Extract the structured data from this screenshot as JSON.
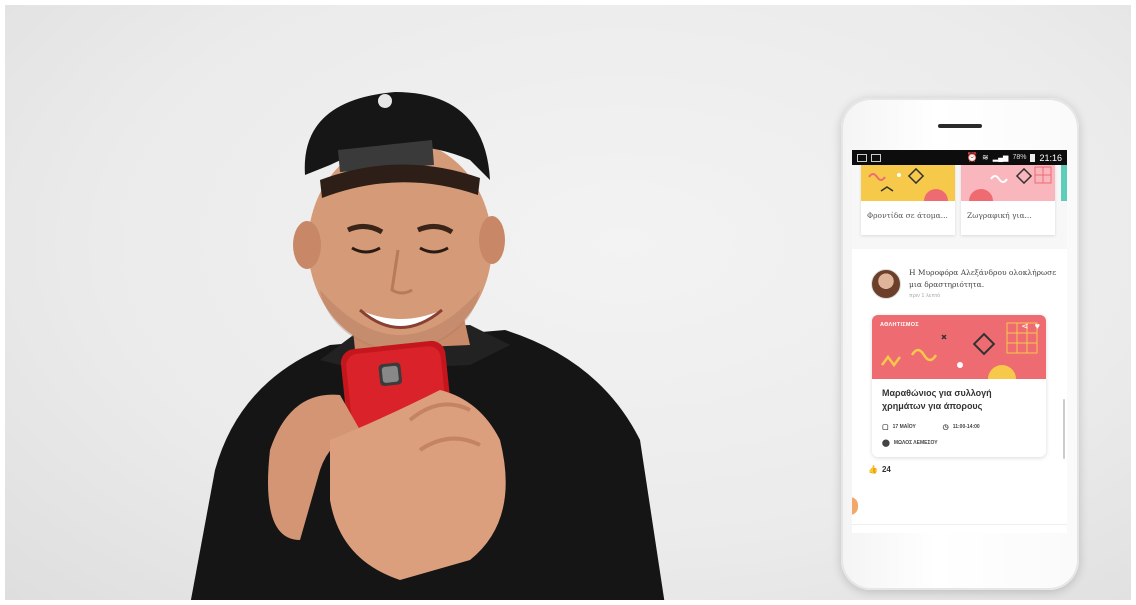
{
  "phone": {
    "status_bar": {
      "battery": "78%",
      "time": "21:16"
    },
    "top_cards": [
      {
        "caption": "Φροντίδα σε άτομα..."
      },
      {
        "caption": "Ζωγραφική για..."
      }
    ],
    "activity": {
      "text": "Η Μυροφόρα Αλεξάνδρου ολοκλήρωσε μια δραστηριότητα.",
      "time": "πριν 1 λεπτό"
    },
    "event": {
      "category": "ΑΘΛΗΤΙΣΜΟΣ",
      "title": "Μαραθώνιος για συλλογή χρημάτων για άπορους",
      "date": "17 ΜΑΪΟΥ",
      "time": "11:00-14:00",
      "location": "ΜΩΛΟΣ ΛΕΜΕΣΟΥ",
      "banner_color": "#ef6b72"
    },
    "likes": {
      "count": "24"
    },
    "nav": {
      "items": [
        {
          "icon": "home-icon",
          "active": true
        },
        {
          "icon": "calendar-icon",
          "active": false
        },
        {
          "icon": "search-icon",
          "active": false
        },
        {
          "icon": "profile-icon",
          "active": false
        },
        {
          "icon": "bell-icon",
          "active": false
        }
      ],
      "accent": "#5ccdb9"
    }
  }
}
